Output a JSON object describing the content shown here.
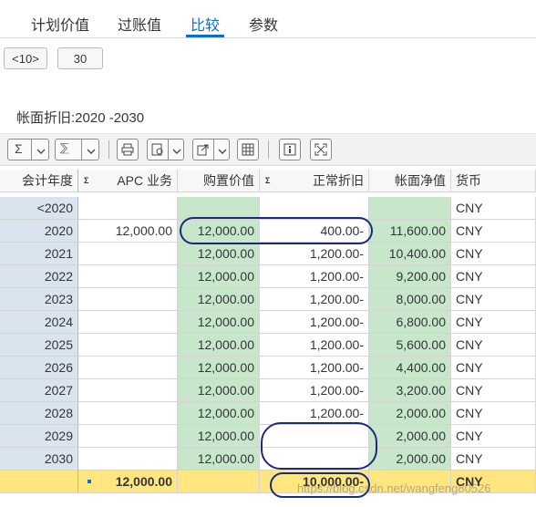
{
  "tabs": [
    {
      "label": "计划价值"
    },
    {
      "label": "过账值"
    },
    {
      "label": "比较"
    },
    {
      "label": "参数"
    }
  ],
  "active_tab": "比较",
  "period_buttons": {
    "prev": "<10>",
    "count": "30"
  },
  "section_title": "帐面折旧:2020 -2030",
  "toolbar_icons": [
    "sum-icon",
    "subtotal-icon",
    "print-icon",
    "view-icon",
    "export-icon",
    "layout-grid-icon",
    "info-icon",
    "fullscreen-icon"
  ],
  "table": {
    "headers": {
      "year": "会计年度",
      "apc": "APC 业务",
      "cost": "购置价值",
      "dep": "正常折旧",
      "nbv": "帐面净值",
      "cur": "货币"
    },
    "rows": [
      {
        "year": "<2020",
        "apc": "",
        "cost": "",
        "dep": "",
        "nbv": "",
        "cur": "CNY"
      },
      {
        "year": "2020",
        "apc": "12,000.00",
        "cost": "12,000.00",
        "dep": "400.00-",
        "nbv": "11,600.00",
        "cur": "CNY"
      },
      {
        "year": "2021",
        "apc": "",
        "cost": "12,000.00",
        "dep": "1,200.00-",
        "nbv": "10,400.00",
        "cur": "CNY"
      },
      {
        "year": "2022",
        "apc": "",
        "cost": "12,000.00",
        "dep": "1,200.00-",
        "nbv": "9,200.00",
        "cur": "CNY"
      },
      {
        "year": "2023",
        "apc": "",
        "cost": "12,000.00",
        "dep": "1,200.00-",
        "nbv": "8,000.00",
        "cur": "CNY"
      },
      {
        "year": "2024",
        "apc": "",
        "cost": "12,000.00",
        "dep": "1,200.00-",
        "nbv": "6,800.00",
        "cur": "CNY"
      },
      {
        "year": "2025",
        "apc": "",
        "cost": "12,000.00",
        "dep": "1,200.00-",
        "nbv": "5,600.00",
        "cur": "CNY"
      },
      {
        "year": "2026",
        "apc": "",
        "cost": "12,000.00",
        "dep": "1,200.00-",
        "nbv": "4,400.00",
        "cur": "CNY"
      },
      {
        "year": "2027",
        "apc": "",
        "cost": "12,000.00",
        "dep": "1,200.00-",
        "nbv": "3,200.00",
        "cur": "CNY"
      },
      {
        "year": "2028",
        "apc": "",
        "cost": "12,000.00",
        "dep": "1,200.00-",
        "nbv": "2,000.00",
        "cur": "CNY"
      },
      {
        "year": "2029",
        "apc": "",
        "cost": "12,000.00",
        "dep": "",
        "nbv": "2,000.00",
        "cur": "CNY"
      },
      {
        "year": "2030",
        "apc": "",
        "cost": "12,000.00",
        "dep": "",
        "nbv": "2,000.00",
        "cur": "CNY"
      }
    ],
    "total": {
      "year": "",
      "apc": "12,000.00",
      "cost": "",
      "dep": "10,000.00-",
      "nbv": "",
      "cur": "CNY"
    }
  },
  "watermark": "https://blog.csdn.net/wangfeng80526"
}
